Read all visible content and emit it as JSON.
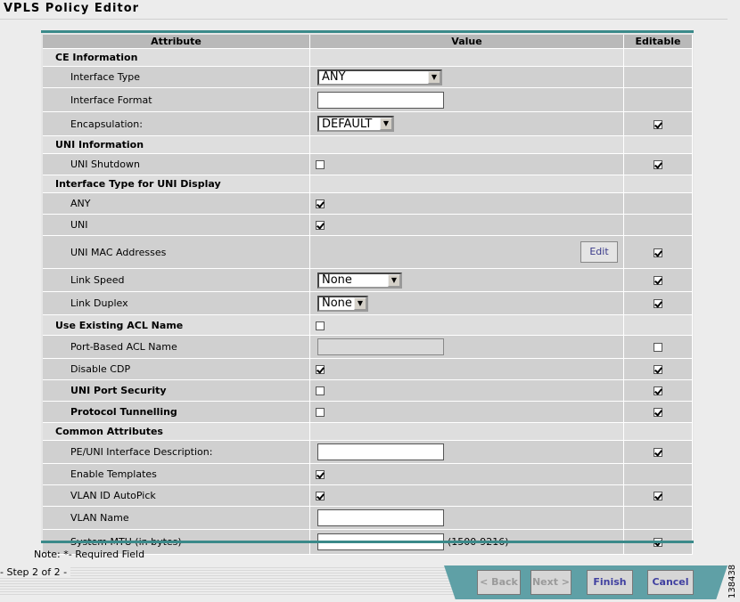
{
  "window": {
    "title": "VPLS Policy Editor"
  },
  "columns": {
    "attribute": "Attribute",
    "value": "Value",
    "editable": "Editable"
  },
  "rows": [
    {
      "kind": "section",
      "label": "CE Information"
    },
    {
      "kind": "attr",
      "label": "Interface Type",
      "control": "select",
      "value": "ANY",
      "editable": null
    },
    {
      "kind": "attr",
      "label": "Interface Format",
      "control": "text",
      "value": "",
      "editable": null
    },
    {
      "kind": "attr",
      "label": "Encapsulation:",
      "control": "select",
      "value": "DEFAULT",
      "editable": true
    },
    {
      "kind": "section",
      "label": "UNI Information"
    },
    {
      "kind": "attr",
      "label": "UNI Shutdown",
      "control": "checkbox",
      "checked": false,
      "editable": true
    },
    {
      "kind": "section",
      "label": "Interface Type for UNI Display"
    },
    {
      "kind": "attr",
      "label": "ANY",
      "control": "checkbox",
      "checked": true,
      "editable": null
    },
    {
      "kind": "attr",
      "label": "UNI",
      "control": "checkbox",
      "checked": true,
      "editable": null
    },
    {
      "kind": "attr",
      "label": "UNI MAC Addresses",
      "control": "button",
      "button_label": "Edit",
      "editable": true
    },
    {
      "kind": "attr",
      "label": "Link Speed",
      "control": "select",
      "value": "None",
      "editable": true
    },
    {
      "kind": "attr",
      "label": "Link Duplex",
      "control": "select",
      "value": "None",
      "editable": true
    },
    {
      "kind": "section",
      "label": "Use Existing ACL Name",
      "control": "checkbox",
      "checked": false
    },
    {
      "kind": "attr",
      "label": "Port-Based ACL Name",
      "control": "text-disabled",
      "value": "",
      "editable": false
    },
    {
      "kind": "attr",
      "label": "Disable CDP",
      "control": "checkbox",
      "checked": true,
      "editable": true
    },
    {
      "kind": "attr",
      "label": "UNI Port Security",
      "bold": true,
      "control": "checkbox",
      "checked": false,
      "editable": true
    },
    {
      "kind": "attr",
      "label": "Protocol Tunnelling",
      "bold": true,
      "control": "checkbox",
      "checked": false,
      "editable": true
    },
    {
      "kind": "section",
      "label": "Common Attributes"
    },
    {
      "kind": "attr",
      "label": "PE/UNI Interface Description:",
      "control": "text",
      "value": "",
      "editable": true
    },
    {
      "kind": "attr",
      "label": "Enable Templates",
      "control": "checkbox",
      "checked": true,
      "editable": null
    },
    {
      "kind": "attr",
      "label": "VLAN ID AutoPick",
      "control": "checkbox",
      "checked": true,
      "editable": true
    },
    {
      "kind": "attr",
      "label": "VLAN Name",
      "control": "text",
      "value": "",
      "editable": null
    },
    {
      "kind": "attr",
      "label": "System MTU (in bytes)",
      "control": "text",
      "value": "",
      "hint": "(1500-9216)",
      "editable": true
    }
  ],
  "note": "Note: *- Required Field",
  "step": "- Step 2 of 2 -",
  "nav": {
    "back": "< Back",
    "next": "Next >",
    "finish": "Finish",
    "cancel": "Cancel"
  },
  "figure_code": "138438"
}
